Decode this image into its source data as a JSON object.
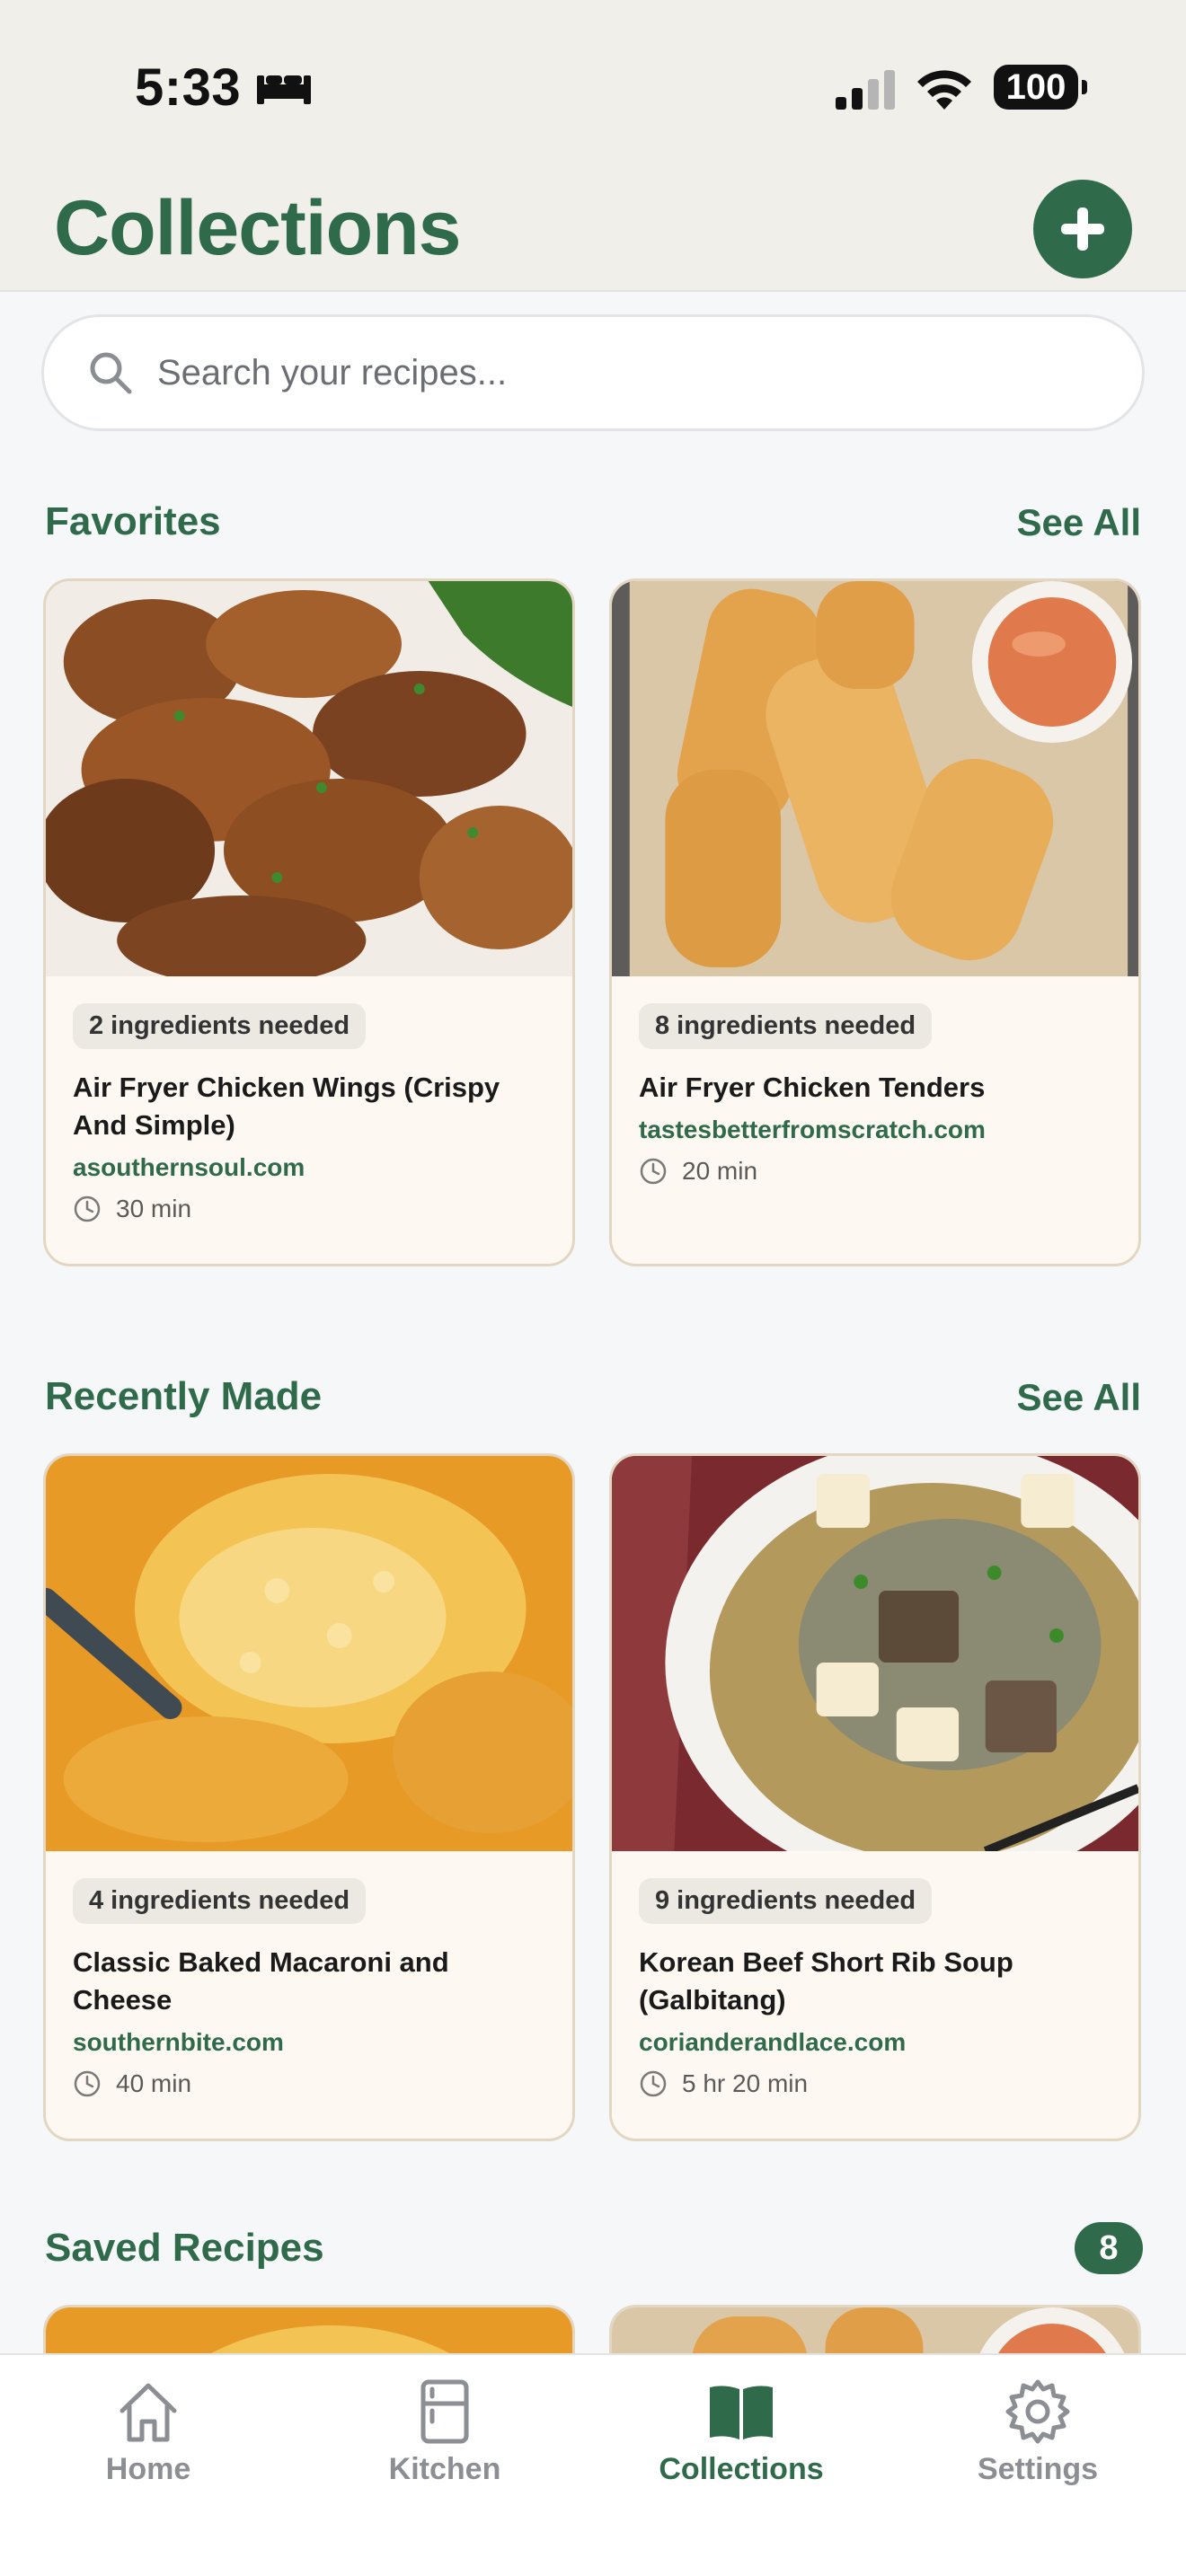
{
  "status": {
    "time": "5:33",
    "battery": "100"
  },
  "header": {
    "title": "Collections"
  },
  "search": {
    "placeholder": "Search your recipes..."
  },
  "sections": {
    "favorites": {
      "title": "Favorites",
      "see_all": "See All",
      "cards": [
        {
          "ingredients": "2 ingredients needed",
          "title": "Air Fryer Chicken Wings (Crispy And Simple)",
          "source": "asouthernsoul.com",
          "time": "30 min"
        },
        {
          "ingredients": "8 ingredients needed",
          "title": "Air Fryer Chicken Tenders",
          "source": "tastesbetterfromscratch.com",
          "time": "20 min"
        }
      ]
    },
    "recent": {
      "title": "Recently Made",
      "see_all": "See All",
      "cards": [
        {
          "ingredients": "4 ingredients needed",
          "title": "Classic Baked Macaroni and Cheese",
          "source": "southernbite.com",
          "time": "40 min"
        },
        {
          "ingredients": "9 ingredients needed",
          "title": "Korean Beef Short Rib Soup (Galbitang)",
          "source": "corianderandlace.com",
          "time": "5 hr 20 min"
        }
      ]
    },
    "saved": {
      "title": "Saved Recipes",
      "count": "8"
    }
  },
  "tabs": [
    {
      "label": "Home",
      "icon": "home-icon"
    },
    {
      "label": "Kitchen",
      "icon": "fridge-icon"
    },
    {
      "label": "Collections",
      "icon": "book-icon",
      "active": true
    },
    {
      "label": "Settings",
      "icon": "gear-icon"
    }
  ],
  "colors": {
    "brand": "#2f6b4a",
    "card_bg": "#fdf8f1",
    "card_border": "#e3d6c2"
  }
}
